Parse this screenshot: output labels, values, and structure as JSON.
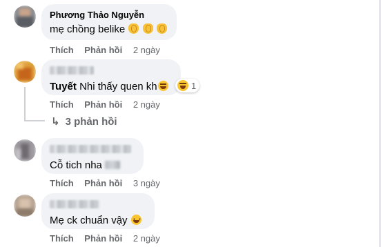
{
  "comments": [
    {
      "author": "Phương Thảo Nguyễn",
      "text": "mẹ chồng belike",
      "emojis": [
        "clapping-hands",
        "clapping-hands",
        "clapping-hands"
      ],
      "actions": {
        "like": "Thích",
        "reply": "Phản hồi",
        "time": "2 ngày"
      }
    },
    {
      "author": "",
      "text_bold": "Tuyết",
      "text": " Nhi thấy quen kh",
      "emojis": [
        "laughing-face"
      ],
      "reaction": {
        "icon": "laughing-face",
        "count": "1"
      },
      "actions": {
        "like": "Thích",
        "reply": "Phản hồi",
        "time": "2 ngày"
      },
      "replies": {
        "label": "3 phản hồi"
      }
    },
    {
      "author": "",
      "text": "Cỗ tich nha ",
      "actions": {
        "like": "Thích",
        "reply": "Phản hồi",
        "time": "3 ngày"
      }
    },
    {
      "author": "",
      "text": "Mẹ ck chuẩn vậy ",
      "emojis": [
        "grinning-face"
      ],
      "actions": {
        "like": "Thích",
        "reply": "Phản hồi",
        "time": "2 ngày"
      }
    }
  ],
  "colors": {
    "bubble_bg": "#f0f2f5",
    "meta_text": "#65676b",
    "body_text": "#050505"
  }
}
